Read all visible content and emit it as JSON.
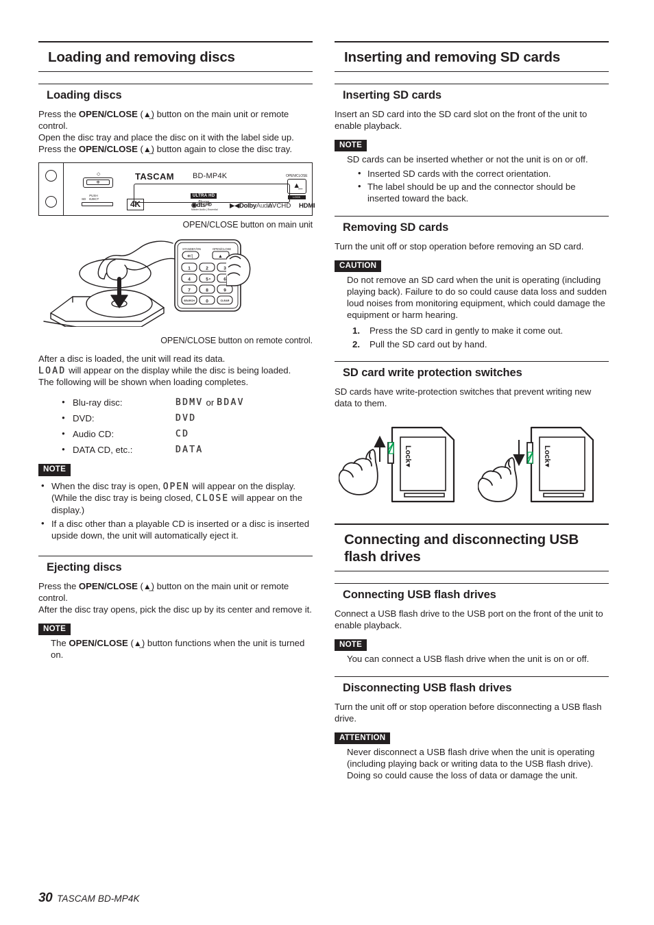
{
  "footer": {
    "page_number": "30",
    "model": "TASCAM BD-MP4K"
  },
  "left_column": {
    "section_title": "Loading and removing discs",
    "loading": {
      "heading": "Loading discs",
      "para1_before": "Press the ",
      "para1_bold": "OPEN/CLOSE",
      "para1_after": ") button on the main unit or remote control.",
      "para2": "Open the disc tray and place the disc on it with the label side up.",
      "para3_before": "Press the ",
      "para3_bold": "OPEN/CLOSE",
      "para3_after": ") button again to close the disc tray.",
      "figure_unit_caption": "OPEN/CLOSE button on main unit",
      "figure_remote_caption": "OPEN/CLOSE button on remote control.",
      "after_load_p1": "After a disc is loaded, the unit will read its data.",
      "after_load_lcd": "LOAD",
      "after_load_p2": " will appear on the display while the disc is being loaded.",
      "after_load_p3": "The following will be shown when loading completes.",
      "formats": [
        {
          "label": "Blu-ray disc:",
          "value": "BDMV",
          "or": "or",
          "value2": "BDAV"
        },
        {
          "label": "DVD:",
          "value": "DVD"
        },
        {
          "label": "Audio CD:",
          "value": "CD"
        },
        {
          "label": "DATA CD, etc.:",
          "value": "DATA"
        }
      ],
      "note_tag": "NOTE",
      "note_items": [
        {
          "seg1": "When the disc tray is open, ",
          "lcd1": "OPEN",
          "seg2": " will appear on the display. (While the disc tray is being closed, ",
          "lcd2": "CLOSE",
          "seg3": " will appear on the display.)"
        },
        {
          "seg1": "If a disc other than a playable CD is inserted or a disc is inserted upside down, the unit will automatically eject it."
        }
      ]
    },
    "ejecting": {
      "heading": "Ejecting discs",
      "para1_before": "Press the ",
      "para1_bold": "OPEN/CLOSE",
      "para1_after": ") button on the main unit or remote control.",
      "para2": "After the disc tray opens, pick the disc up by its center and remove it.",
      "note_tag": "NOTE",
      "note_before": "The ",
      "note_bold": "OPEN/CLOSE",
      "note_after": ") button functions when the unit is turned on."
    }
  },
  "right_column": {
    "sd_section_title": "Inserting and removing SD cards",
    "inserting": {
      "heading": "Inserting SD cards",
      "para1": "Insert an SD card into the SD card slot on the front of the unit to enable playback.",
      "note_tag": "NOTE",
      "note_lead": "SD cards can be inserted whether or not the unit is on or off.",
      "note_bullets": [
        "Inserted SD cards with the correct orientation.",
        "The label should be up and the connector should be inserted toward the back."
      ]
    },
    "removing": {
      "heading": "Removing SD cards",
      "para1": "Turn the unit off or stop operation before removing an SD card.",
      "caution_tag": "CAUTION",
      "caution_body": "Do not remove an SD card when the unit is operating (including playing back). Failure to do so could cause data loss and sudden loud noises from monitoring equipment, which could damage the equipment or harm hearing.",
      "steps": [
        "Press the SD card in gently to make it come out.",
        "Pull the SD card out by hand."
      ]
    },
    "write_protect": {
      "heading": "SD card write protection switches",
      "para1": "SD cards have write-protection switches that prevent writing new data to them.",
      "lock_label": "Lock"
    },
    "usb_section_title": "Connecting and disconnecting USB flash drives",
    "connecting": {
      "heading": "Connecting USB flash drives",
      "para1": "Connect a USB flash drive to the USB port on the front of the unit to enable playback.",
      "note_tag": "NOTE",
      "note_body": "You can connect a USB flash drive when the unit is on or off."
    },
    "disconnecting": {
      "heading": "Disconnecting USB flash drives",
      "para1": "Turn the unit off or stop operation before disconnecting a USB flash drive.",
      "attention_tag": "ATTENTION",
      "attention_body": "Never disconnect a USB flash drive when the unit is operating (including playing back or writing data to the USB flash drive). Doing so could cause the loss of data or damage the unit."
    }
  },
  "unit_illustration": {
    "brand": "TASCAM",
    "model": "BD-MP4K",
    "disc_logo_line1": "ULTRA HD",
    "disc_logo_line2": "Blu-ray",
    "logo_4k": "4K",
    "logo_dts": "dts",
    "logo_dts_sup": "HD",
    "logo_dts_sub": "Master Audio | Essential",
    "logo_dolby_bold": "Dolby",
    "logo_dolby_light": "Audio",
    "logo_avchd": "AVCHD",
    "logo_hdmi": "HDMI",
    "openclose_label": "OPEN/CLOSE",
    "openclose_sub": "LOCK",
    "sd_label_1": "SD",
    "sd_label_2a": "PUSH",
    "sd_label_2b": "EJECT"
  },
  "remote_illustration": {
    "standby_label": "STANDBY/ON",
    "openclose_label": "OPEN/CLOSE",
    "keys": [
      "1",
      "2",
      "3",
      "4",
      "5",
      "6",
      "7",
      "8",
      "9",
      "SEARCH",
      "0",
      "CLEAR"
    ]
  },
  "colors": {
    "text": "#231f20",
    "lcd": "#3d3a3b",
    "switch_green": "#00a651"
  }
}
